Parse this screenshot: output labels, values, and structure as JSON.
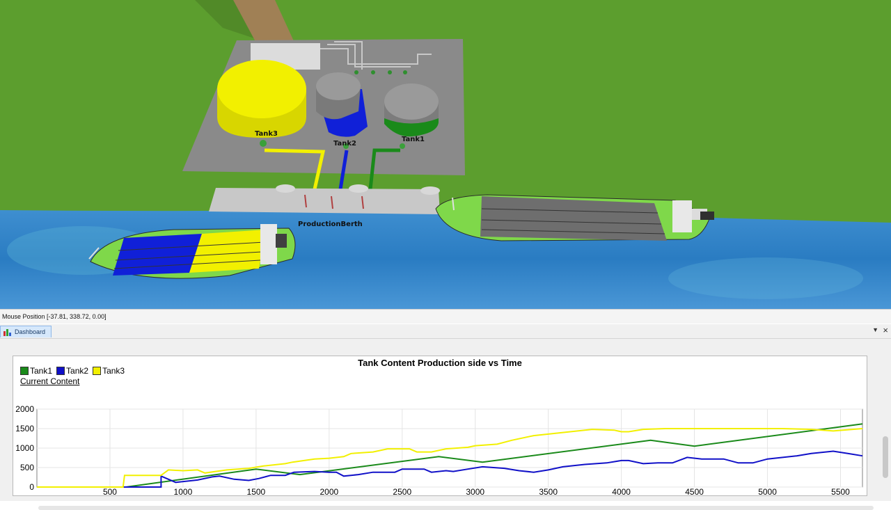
{
  "scene": {
    "labels": {
      "tank3": "Tank3",
      "tank2": "Tank2",
      "tank1": "Tank1",
      "berth": "ProductionBerth"
    },
    "colors": {
      "grass": "#5c9e2e",
      "water": "#2f7fc4",
      "pad": "#8a8a8a",
      "tank3": "#f2f000",
      "tank2": "#1020d8",
      "tank1": "#1a8a1a",
      "ship_deck": "#7fd84a"
    }
  },
  "status_bar": {
    "mouse_position": "Mouse Position [-37.81, 338.72, 0.00]"
  },
  "dashboard": {
    "tab_label": "Dashboard",
    "menu_icon": "dropdown-arrow-icon",
    "close_icon": "close-icon",
    "chart_data": {
      "type": "line",
      "title": "Tank Content Production side vs Time",
      "xlabel": "",
      "ylabel": "Current Content",
      "xlim": [
        0,
        5650
      ],
      "ylim": [
        0,
        2000
      ],
      "x_ticks": [
        500,
        1000,
        1500,
        2000,
        2500,
        3000,
        3500,
        4000,
        4500,
        5000,
        5500
      ],
      "y_ticks": [
        0,
        500,
        1000,
        1500,
        2000
      ],
      "grid": true,
      "legend": "top-left",
      "series": [
        {
          "name": "Tank1",
          "color": "#1a8a1a",
          "points": [
            [
              0,
              0
            ],
            [
              610,
              0
            ],
            [
              1500,
              460
            ],
            [
              1800,
              320
            ],
            [
              2750,
              780
            ],
            [
              3050,
              640
            ],
            [
              4200,
              1200
            ],
            [
              4500,
              1050
            ],
            [
              5650,
              1620
            ]
          ]
        },
        {
          "name": "Tank2",
          "color": "#1010c8",
          "points": [
            [
              0,
              0
            ],
            [
              850,
              0
            ],
            [
              850,
              280
            ],
            [
              950,
              120
            ],
            [
              1100,
              180
            ],
            [
              1200,
              260
            ],
            [
              1250,
              280
            ],
            [
              1350,
              200
            ],
            [
              1450,
              170
            ],
            [
              1520,
              220
            ],
            [
              1600,
              300
            ],
            [
              1700,
              300
            ],
            [
              1760,
              380
            ],
            [
              1900,
              400
            ],
            [
              2000,
              380
            ],
            [
              2050,
              380
            ],
            [
              2100,
              280
            ],
            [
              2200,
              320
            ],
            [
              2300,
              380
            ],
            [
              2450,
              380
            ],
            [
              2500,
              460
            ],
            [
              2650,
              460
            ],
            [
              2700,
              380
            ],
            [
              2800,
              420
            ],
            [
              2850,
              400
            ],
            [
              2950,
              460
            ],
            [
              3050,
              520
            ],
            [
              3200,
              480
            ],
            [
              3300,
              420
            ],
            [
              3400,
              380
            ],
            [
              3500,
              440
            ],
            [
              3600,
              520
            ],
            [
              3750,
              580
            ],
            [
              3900,
              620
            ],
            [
              4000,
              680
            ],
            [
              4050,
              680
            ],
            [
              4150,
              600
            ],
            [
              4250,
              620
            ],
            [
              4350,
              620
            ],
            [
              4450,
              760
            ],
            [
              4550,
              720
            ],
            [
              4700,
              720
            ],
            [
              4800,
              620
            ],
            [
              4900,
              620
            ],
            [
              5000,
              720
            ],
            [
              5200,
              800
            ],
            [
              5300,
              860
            ],
            [
              5450,
              920
            ],
            [
              5550,
              860
            ],
            [
              5650,
              800
            ]
          ]
        },
        {
          "name": "Tank3",
          "color": "#f2f000",
          "points": [
            [
              0,
              0
            ],
            [
              590,
              0
            ],
            [
              600,
              300
            ],
            [
              850,
              300
            ],
            [
              900,
              440
            ],
            [
              1000,
              420
            ],
            [
              1100,
              440
            ],
            [
              1150,
              360
            ],
            [
              1300,
              440
            ],
            [
              1450,
              480
            ],
            [
              1550,
              540
            ],
            [
              1700,
              600
            ],
            [
              1750,
              640
            ],
            [
              1900,
              720
            ],
            [
              2000,
              740
            ],
            [
              2100,
              780
            ],
            [
              2150,
              860
            ],
            [
              2300,
              900
            ],
            [
              2400,
              980
            ],
            [
              2550,
              980
            ],
            [
              2600,
              900
            ],
            [
              2700,
              900
            ],
            [
              2800,
              980
            ],
            [
              2950,
              1020
            ],
            [
              3000,
              1060
            ],
            [
              3150,
              1100
            ],
            [
              3250,
              1200
            ],
            [
              3400,
              1320
            ],
            [
              3550,
              1380
            ],
            [
              3650,
              1420
            ],
            [
              3800,
              1480
            ],
            [
              3950,
              1460
            ],
            [
              4000,
              1420
            ],
            [
              4050,
              1420
            ],
            [
              4150,
              1480
            ],
            [
              4300,
              1500
            ],
            [
              4500,
              1500
            ],
            [
              4700,
              1500
            ],
            [
              4900,
              1500
            ],
            [
              5100,
              1500
            ],
            [
              5300,
              1480
            ],
            [
              5450,
              1440
            ],
            [
              5650,
              1500
            ]
          ]
        }
      ]
    }
  }
}
